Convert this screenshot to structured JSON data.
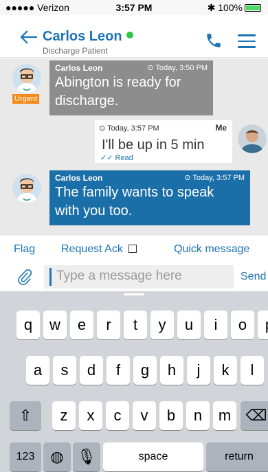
{
  "status_bar": {
    "carrier": "●●●●● Verizon",
    "time": "3:57 PM",
    "battery": "100%"
  },
  "header": {
    "name": "Carlos Leon",
    "subtitle": "Discharge Patient"
  },
  "messages": [
    {
      "sender": "Carlos Leon",
      "time": "Today, 3:50 PM",
      "text1": "Abington is ready for",
      "text2": "discharge.",
      "badge": "Urgent"
    },
    {
      "sender": "Me",
      "time": "Today, 3:57 PM",
      "text": "I'll be up in 5 min",
      "status": "Read"
    },
    {
      "sender": "Carlos Leon",
      "time": "Today, 3:57 PM",
      "text1": "The family wants to speak",
      "text2": "with you too."
    }
  ],
  "actions": {
    "flag": "Flag",
    "request_ack": "Request Ack",
    "quick_message": "Quick message"
  },
  "composer": {
    "placeholder": "Type a message here",
    "send": "Send"
  },
  "keyboard": {
    "row1": [
      "q",
      "w",
      "e",
      "r",
      "t",
      "y",
      "u",
      "i",
      "o",
      "p"
    ],
    "row2": [
      "a",
      "s",
      "d",
      "f",
      "g",
      "h",
      "j",
      "k",
      "l"
    ],
    "row3": [
      "z",
      "x",
      "c",
      "v",
      "b",
      "n",
      "m"
    ],
    "numbers": "123",
    "space": "space",
    "return": "return"
  }
}
